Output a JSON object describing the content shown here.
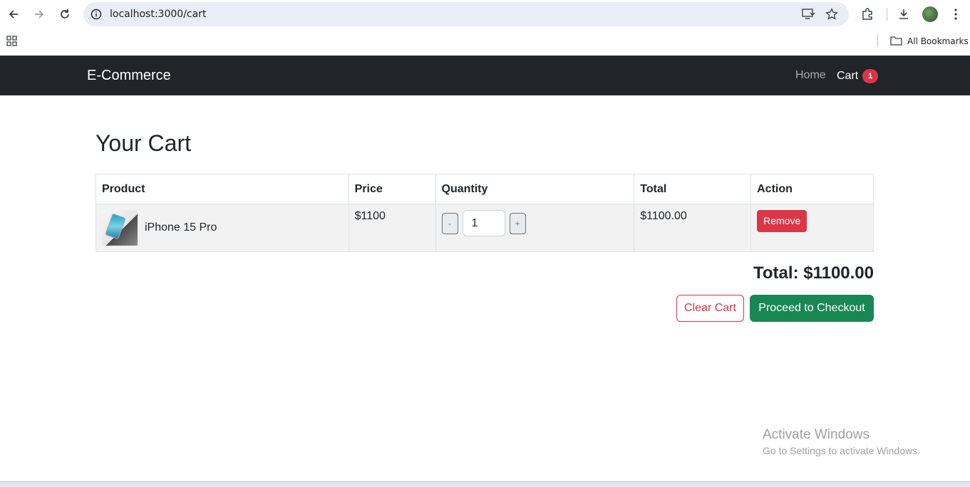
{
  "browser": {
    "url": "localhost:3000/cart",
    "bookmarks_label": "All Bookmarks"
  },
  "navbar": {
    "brand": "E-Commerce",
    "home": "Home",
    "cart": "Cart",
    "cart_count": "1"
  },
  "page": {
    "title": "Your Cart"
  },
  "table": {
    "headers": [
      "Product",
      "Price",
      "Quantity",
      "Total",
      "Action"
    ],
    "rows": [
      {
        "product": "iPhone 15 Pro",
        "price": "$1100",
        "qty_minus": "-",
        "quantity": "1",
        "qty_plus": "+",
        "total": "$1100.00",
        "action": "Remove"
      }
    ]
  },
  "summary": {
    "total": "Total: $1100.00",
    "clear_label": "Clear Cart",
    "checkout_label": "Proceed to Checkout"
  },
  "watermark": {
    "title": "Activate Windows",
    "subtitle": "Go to Settings to activate Windows."
  },
  "colors": {
    "navbar_bg": "#212529",
    "danger": "#dc3545",
    "success": "#198754"
  }
}
